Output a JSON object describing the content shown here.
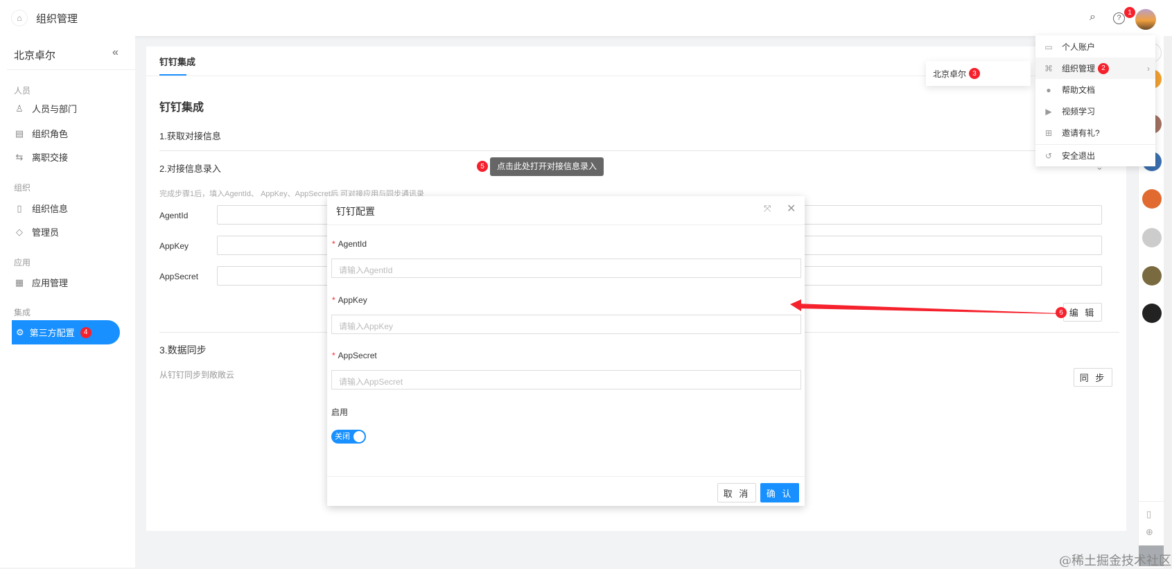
{
  "header": {
    "title": "组织管理",
    "home_icon": "home-icon",
    "search_icon": "search-icon",
    "help_icon": "help-icon",
    "avatar_badge": "1"
  },
  "sidebar": {
    "org_name": "北京卓尔",
    "collapse_icon": "«",
    "groups": [
      {
        "label": "人员",
        "items": [
          {
            "label": "人员与部门",
            "icon": "person-icon"
          },
          {
            "label": "组织角色",
            "icon": "role-icon"
          },
          {
            "label": "离职交接",
            "icon": "transfer-icon"
          }
        ]
      },
      {
        "label": "组织",
        "items": [
          {
            "label": "组织信息",
            "icon": "document-icon"
          },
          {
            "label": "管理员",
            "icon": "shield-icon"
          }
        ]
      },
      {
        "label": "应用",
        "items": [
          {
            "label": "应用管理",
            "icon": "grid-icon"
          }
        ]
      },
      {
        "label": "集成",
        "items": [
          {
            "label": "第三方配置",
            "icon": "gear-icon",
            "active": true,
            "badge": "4"
          }
        ]
      }
    ]
  },
  "main": {
    "tab": "钉钉集成",
    "title": "钉钉集成",
    "step1": "1.获取对接信息",
    "step2": "2.对接信息录入",
    "hint": "完成步骤1后，填入AgentId、 AppKey、AppSecret后 可对接应用与同步通讯录",
    "fields": [
      "AgentId",
      "AppKey",
      "AppSecret"
    ],
    "edit_button": "编 辑",
    "edit_badge": "6",
    "step3": "3.数据同步",
    "sync_desc": "从钉钉同步到敞敞云",
    "sync_button": "同 步",
    "tooltip": "点击此处打开对接信息录入",
    "tooltip_badge": "5"
  },
  "modal": {
    "title": "钉钉配置",
    "fields": [
      {
        "label": "AgentId",
        "placeholder": "请输入AgentId"
      },
      {
        "label": "AppKey",
        "placeholder": "请输入AppKey"
      },
      {
        "label": "AppSecret",
        "placeholder": "请输入AppSecret"
      }
    ],
    "enable_label": "启用",
    "switch_text": "关闭",
    "cancel": "取 消",
    "confirm": "确 认",
    "accent": "#1890ff"
  },
  "user_menu": {
    "items": [
      {
        "label": "个人账户",
        "icon": "id-card-icon"
      },
      {
        "label": "组织管理",
        "icon": "org-icon",
        "badge": "2"
      },
      {
        "label": "帮助文档",
        "icon": "help-circle-icon"
      },
      {
        "label": "视频学习",
        "icon": "play-icon"
      },
      {
        "label": "邀请有礼?",
        "icon": "gift-icon"
      },
      {
        "label": "安全退出",
        "icon": "logout-icon"
      }
    ],
    "submenu": {
      "label": "北京卓尔",
      "badge": "3"
    }
  },
  "watermark": "@稀土掘金技术社区"
}
